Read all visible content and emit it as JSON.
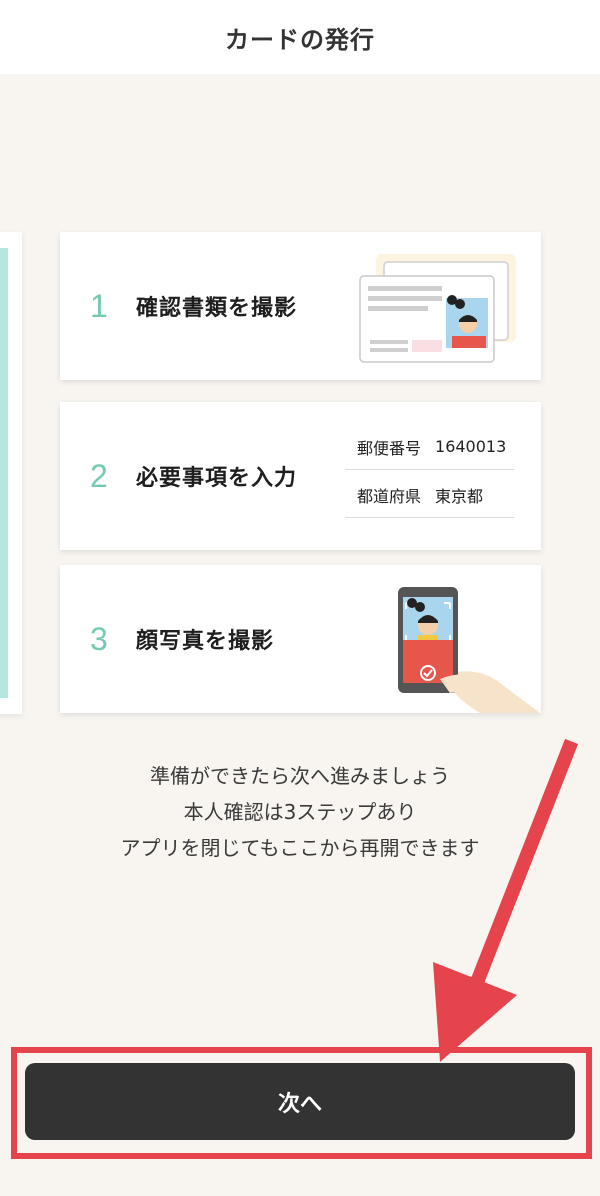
{
  "header": {
    "title": "カードの発行"
  },
  "steps": [
    {
      "number": "1",
      "label": "確認書類を撮影"
    },
    {
      "number": "2",
      "label": "必要事項を入力",
      "form": [
        {
          "label": "郵便番号",
          "value": "1640013"
        },
        {
          "label": "都道府県",
          "value": "東京都"
        }
      ]
    },
    {
      "number": "3",
      "label": "顔写真を撮影"
    }
  ],
  "message": {
    "line1": "準備ができたら次へ進みましょう",
    "line2": "本人確認は3ステップあり",
    "line3": "アプリを閉じてもここから再開できます"
  },
  "next_button": {
    "label": "次へ"
  },
  "colors": {
    "accent_teal": "#73c9b3",
    "annotation_red": "#e5444d",
    "button_dark": "#333333",
    "background": "#f8f5f0"
  }
}
